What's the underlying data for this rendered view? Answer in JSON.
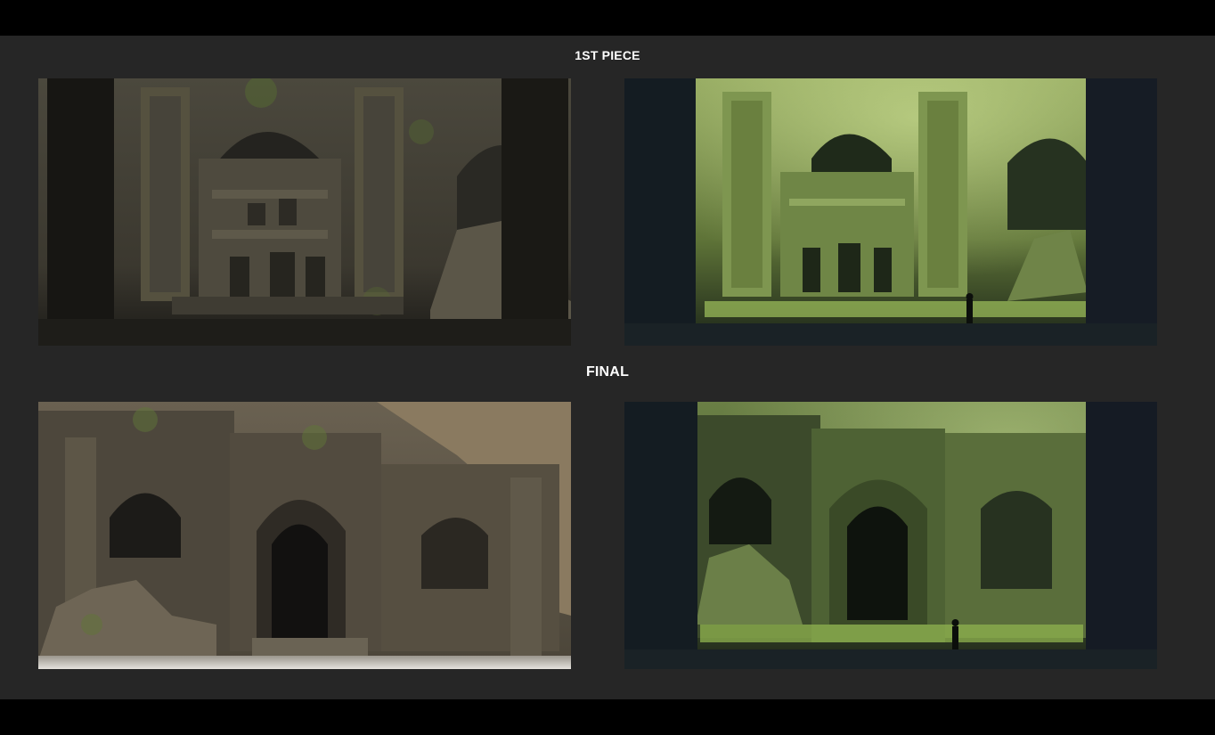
{
  "headings": {
    "first_piece": "1ST PIECE",
    "final": "FINAL"
  },
  "artworks": [
    {
      "name": "first-piece-render",
      "palette": [
        "#3a372f",
        "#4a463b",
        "#1a1916"
      ]
    },
    {
      "name": "first-piece-paintover",
      "palette": [
        "#6f8a3e",
        "#9fbf5a",
        "#0c1216"
      ]
    },
    {
      "name": "final-render",
      "palette": [
        "#5b5446",
        "#7a7060",
        "#1b1a17"
      ]
    },
    {
      "name": "final-paintover",
      "palette": [
        "#4f6a34",
        "#86a653",
        "#0d1317"
      ]
    }
  ]
}
